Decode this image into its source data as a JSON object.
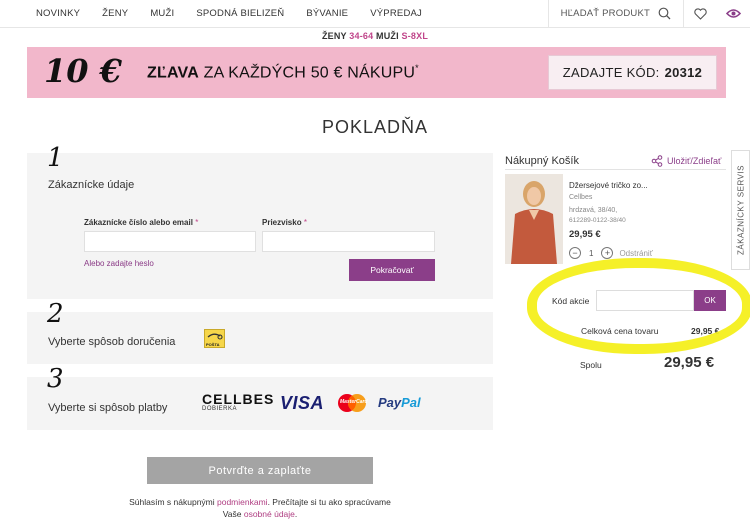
{
  "nav": {
    "items": [
      "NOVINKY",
      "ŽENY",
      "MUŽI",
      "SPODNÁ BIELIZEŇ",
      "BÝVANIE",
      "VÝPREDAJ"
    ],
    "search_label": "HĽADAŤ PRODUKT"
  },
  "promo_line": {
    "part1": "ŽENY ",
    "part2": "34-64",
    "part3": " MUŽI ",
    "part4": "S-8XL"
  },
  "banner": {
    "big": "10 €",
    "bold": "ZĽAVA",
    "text": " ZA KAŽDÝCH 50 € NÁKUPU",
    "sup": "*",
    "code_label": "ZADAJTE KÓD:",
    "code": "20312"
  },
  "page_title": "POKLADŇA",
  "step1": {
    "num": "1",
    "title": "Zákaznícke údaje",
    "email_label": "Zákaznícke číslo alebo email",
    "surname_label": "Priezvisko",
    "required_mark": "*",
    "password_link": "Alebo zadajte heslo",
    "continue_button": "Pokračovať"
  },
  "step2": {
    "num": "2",
    "title": "Vyberte spôsob doručenia",
    "posta_logo": "POŠTA"
  },
  "step3": {
    "num": "3",
    "title": "Vyberte si spôsob platby",
    "cellbes": "CELLBES",
    "cellbes_sub": "DOBIERKA",
    "visa": "VISA",
    "mastercard": "MasterCard",
    "paypal_pay": "Pay",
    "paypal_pal": "Pal"
  },
  "confirm_button": "Potvrďte a zaplaťte",
  "terms": {
    "t1": "Súhlasím s nákupnými ",
    "link1": "podmienkami",
    "t2": ". Prečítajte si tu ako spracúvame",
    "t3": "Vaše ",
    "link2": "osobné údaje",
    "t4": "."
  },
  "cart": {
    "title": "Nákupný Košík",
    "save_share": "Uložiť/Zdieľať",
    "product": {
      "name": "Džersejové tričko zo...",
      "brand": "Cellbes",
      "variant": "hrdzavá, 38/40,",
      "sku": "612289-0122-38/40",
      "price": "29,95 €",
      "qty": "1",
      "remove": "Odstrániť"
    },
    "promo_label": "Kód akcie",
    "promo_button": "OK",
    "subtotal_label": "Celková cena tovaru",
    "subtotal_value": "29,95 €",
    "total_label": "Spolu",
    "total_value": "29,95 €"
  },
  "side_tab": "ZÁKAZNÍCKY SERVIS",
  "colors": {
    "brand_purple": "#8b3e89",
    "banner_pink": "#f2b7cb",
    "highlight_yellow": "#f4ef1c"
  }
}
